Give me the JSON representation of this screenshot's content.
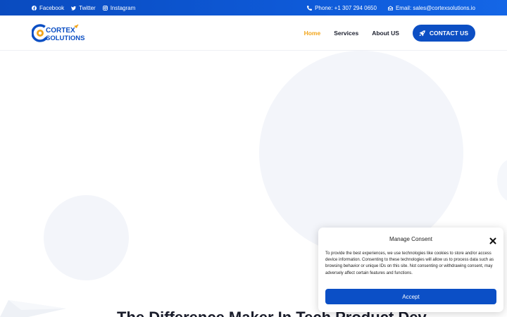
{
  "topbar": {
    "social": [
      {
        "label": "Facebook",
        "icon": "facebook-icon"
      },
      {
        "label": "Twitter",
        "icon": "twitter-icon"
      },
      {
        "label": "Instagram",
        "icon": "instagram-icon"
      }
    ],
    "phone": "Phone: +1 307 294 0650",
    "email": "Email: sales@cortexsolutions.io"
  },
  "header": {
    "logo": {
      "line1": "CORTEX",
      "line2": "SOLUTIONS"
    },
    "nav": [
      {
        "label": "Home",
        "active": true
      },
      {
        "label": "Services",
        "active": false
      },
      {
        "label": "About US",
        "active": false
      }
    ],
    "cta_label": "CONTACT US"
  },
  "hero": {
    "heading": "The Difference Maker In Tech Product Dev"
  },
  "consent": {
    "title": "Manage Consent",
    "body": "To provide the best experiences, we use technologies like cookies to store and/or access device information. Consenting to these technologies will allow us to process data such as browsing behavior or unique IDs on this site. Not consenting or withdrawing consent, may adversely affect certain features and functions.",
    "accept_label": "Accept"
  },
  "colors": {
    "brand_blue": "#0c4fc4",
    "accent_orange": "#f2a51a",
    "topbar_blue": "#0e5ad8"
  }
}
